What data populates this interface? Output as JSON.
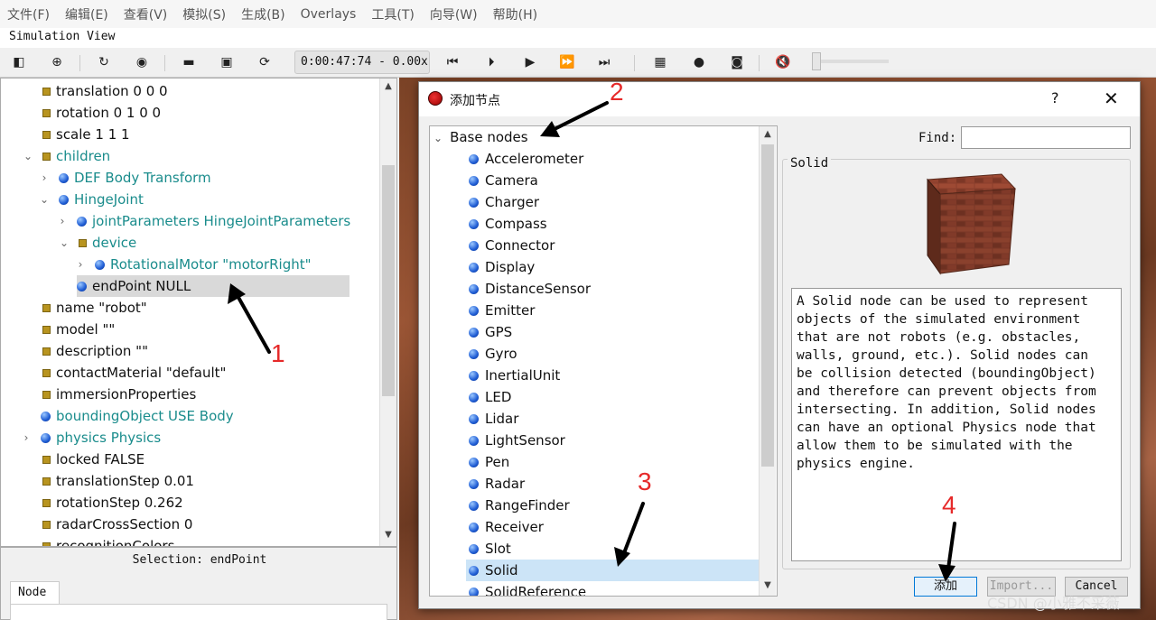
{
  "menubar": [
    "文件(F)",
    "编辑(E)",
    "查看(V)",
    "模拟(S)",
    "生成(B)",
    "Overlays",
    "工具(T)",
    "向导(W)",
    "帮助(H)"
  ],
  "sim_view_title": "Simulation View",
  "toolbar": {
    "time": "0:00:47:74 -  0.00x"
  },
  "icons": [
    "split-view-icon",
    "add-icon",
    "reload-icon",
    "eye-icon",
    "open-folder-icon",
    "save-icon",
    "revert-icon",
    "step-back-icon",
    "step-icon",
    "play-icon",
    "fast-forward-icon",
    "faster-icon",
    "video-icon",
    "record-icon",
    "camera-icon",
    "mute-icon"
  ],
  "tree": [
    {
      "label": "translation 0 0 0",
      "kind": "sq",
      "indent": 0
    },
    {
      "label": "rotation 0 1 0 0",
      "kind": "sq",
      "indent": 0
    },
    {
      "label": "scale 1 1 1",
      "kind": "sq",
      "indent": 0
    },
    {
      "label": "children",
      "kind": "sq",
      "indent": 0,
      "teal": true,
      "open": true
    },
    {
      "label": "DEF Body Transform",
      "kind": "ci",
      "indent": 1,
      "teal": true,
      "closed": true
    },
    {
      "label": "HingeJoint",
      "kind": "ci",
      "indent": 1,
      "teal": true,
      "open": true
    },
    {
      "label": "jointParameters HingeJointParameters",
      "kind": "ci",
      "indent": 2,
      "teal": true,
      "closed": true
    },
    {
      "label": "device",
      "kind": "sq",
      "indent": 2,
      "teal": true,
      "open": true
    },
    {
      "label": "RotationalMotor \"motorRight\"",
      "kind": "ci",
      "indent": 3,
      "teal": true,
      "closed": true
    },
    {
      "label": "endPoint NULL",
      "kind": "ci",
      "indent": 2,
      "sel": true
    },
    {
      "label": "name \"robot\"",
      "kind": "sq",
      "indent": 0
    },
    {
      "label": "model \"\"",
      "kind": "sq",
      "indent": 0
    },
    {
      "label": "description \"\"",
      "kind": "sq",
      "indent": 0
    },
    {
      "label": "contactMaterial \"default\"",
      "kind": "sq",
      "indent": 0
    },
    {
      "label": "immersionProperties",
      "kind": "sq",
      "indent": 0
    },
    {
      "label": "boundingObject USE Body",
      "kind": "ci",
      "indent": 0,
      "teal": true
    },
    {
      "label": "physics Physics",
      "kind": "ci",
      "indent": 0,
      "teal": true,
      "closed": true
    },
    {
      "label": "locked FALSE",
      "kind": "sq",
      "indent": 0
    },
    {
      "label": "translationStep 0.01",
      "kind": "sq",
      "indent": 0
    },
    {
      "label": "rotationStep 0.262",
      "kind": "sq",
      "indent": 0
    },
    {
      "label": "radarCrossSection 0",
      "kind": "sq",
      "indent": 0
    },
    {
      "label": "recognitionColors",
      "kind": "sq",
      "indent": 0
    }
  ],
  "selection": "Selection: endPoint",
  "node_tab": "Node",
  "dialog": {
    "title": "添加节点",
    "help": "?",
    "close": "✕",
    "root": "Base nodes",
    "nodes": [
      "Accelerometer",
      "Camera",
      "Charger",
      "Compass",
      "Connector",
      "Display",
      "DistanceSensor",
      "Emitter",
      "GPS",
      "Gyro",
      "InertialUnit",
      "LED",
      "Lidar",
      "LightSensor",
      "Pen",
      "Radar",
      "RangeFinder",
      "Receiver",
      "Slot",
      "Solid",
      "SolidReference"
    ],
    "selected": "Solid",
    "find_label": "Find:",
    "find_value": "",
    "group_title": "Solid",
    "description": "A Solid node can be used to represent\nobjects of the simulated environment\nthat are not robots (e.g. obstacles,\nwalls, ground, etc.). Solid nodes can\nbe collision detected (boundingObject)\nand therefore can prevent objects from\nintersecting. In addition, Solid nodes\ncan have an optional Physics node that\nallow them to be simulated with the\nphysics engine.",
    "add_button": "添加",
    "import_button": "Import...",
    "cancel_button": "Cancel"
  },
  "annotations": [
    "1",
    "2",
    "3",
    "4"
  ],
  "watermark": "CSDN @小雅不采薇"
}
